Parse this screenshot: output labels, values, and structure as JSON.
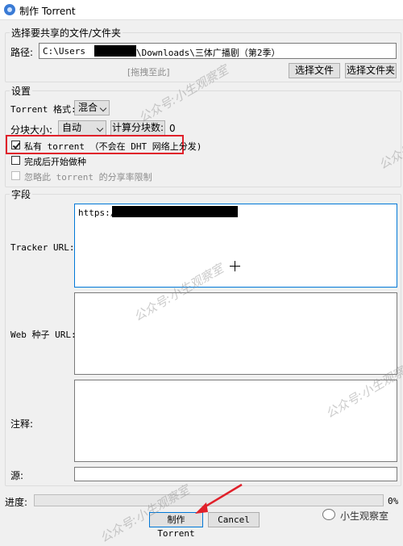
{
  "window": {
    "title": "制作 Torrent"
  },
  "files": {
    "legend": "选择要共享的文件/文件夹",
    "path_label": "路径:",
    "path_prefix": "C:\\Users",
    "path_suffix": "\\Downloads\\三体广播剧（第2季）",
    "drag_hint": "[拖拽至此]",
    "select_file": "选择文件",
    "select_folder": "选择文件夹"
  },
  "settings": {
    "legend": "设置",
    "format_label": "Torrent 格式:",
    "format_value": "混合",
    "piece_label": "分块大小:",
    "piece_value": "自动",
    "calc_pieces": "计算分块数:",
    "pieces_count": "0",
    "private_label": "私有 torrent （不会在 DHT 网络上分发)",
    "private_checked": true,
    "seed_label": "完成后开始做种",
    "seed_checked": false,
    "ignore_label": "忽略此 torrent 的分享率限制",
    "ignore_checked": false
  },
  "fields": {
    "legend": "字段",
    "tracker_label": "Tracker URL:",
    "tracker_value": "https://",
    "web_seed_label": "Web 种子 URL:",
    "comment_label": "注释:",
    "source_label": "源:"
  },
  "footer": {
    "progress_label": "进度:",
    "progress_value": 0,
    "progress_text": "0%",
    "create_button": "制作 Torrent",
    "cancel_button": "Cancel"
  },
  "watermark": {
    "text": "公众号:小生观察室",
    "brand": "小生观察室"
  },
  "colors": {
    "highlight": "#e0202a",
    "accent": "#0078d7"
  }
}
